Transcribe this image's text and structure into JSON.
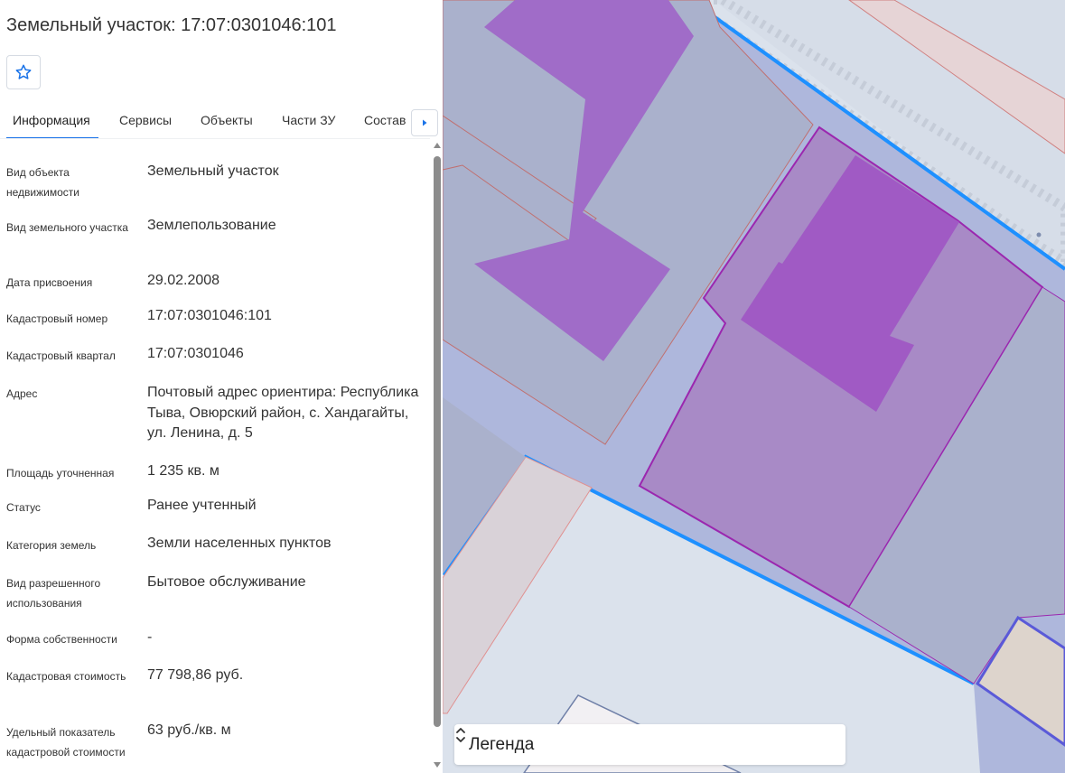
{
  "title": "Земельный участок: 17:07:0301046:101",
  "favorite": {
    "icon": "star-outline-icon"
  },
  "tabs": [
    {
      "label": "Информация",
      "active": true
    },
    {
      "label": "Сервисы"
    },
    {
      "label": "Объекты"
    },
    {
      "label": "Части ЗУ"
    },
    {
      "label": "Состав"
    }
  ],
  "tabs_next_icon": "caret-right-icon",
  "info": {
    "object_type": {
      "label": "Вид объекта недвижимости",
      "value": "Земельный участок"
    },
    "land_type": {
      "label": "Вид земельного участка",
      "value": "Землепользование"
    },
    "assign_date": {
      "label": "Дата присвоения",
      "value": "29.02.2008"
    },
    "cadastral_number": {
      "label": "Кадастровый номер",
      "value": "17:07:0301046:101"
    },
    "cadastral_quarter": {
      "label": "Кадастровый квартал",
      "value": "17:07:0301046"
    },
    "address": {
      "label": "Адрес",
      "value": "Почтовый адрес ориентира: Республика Тыва, Овюрский район, с. Хандагайты, ул. Ленина, д. 5"
    },
    "area": {
      "label": "Площадь уточненная",
      "value": "1 235 кв. м"
    },
    "status": {
      "label": "Статус",
      "value": "Ранее учтенный"
    },
    "land_category": {
      "label": "Категория земель",
      "value": "Земли населенных пунктов"
    },
    "permitted_use": {
      "label": "Вид разрешенного использования",
      "value": "Бытовое обслуживание"
    },
    "ownership": {
      "label": "Форма собственности",
      "value": "-"
    },
    "cadastral_value": {
      "label": "Кадастровая стоимость",
      "value": "77 798,86 руб."
    },
    "specific_value": {
      "label": "Удельный показатель кадастровой стоимости",
      "value": "63 руб./кв. м"
    }
  },
  "legend": {
    "label": "Легенда",
    "icon": "chevron-up-down-icon"
  },
  "colors": {
    "accent": "#1a73e8",
    "parcel_fill": "#aab1cc",
    "selected_parcel_border": "#1e90ff",
    "building_fill": "#a066c8",
    "building_border": "#9b27af",
    "map_background": "#dbe2ec"
  }
}
